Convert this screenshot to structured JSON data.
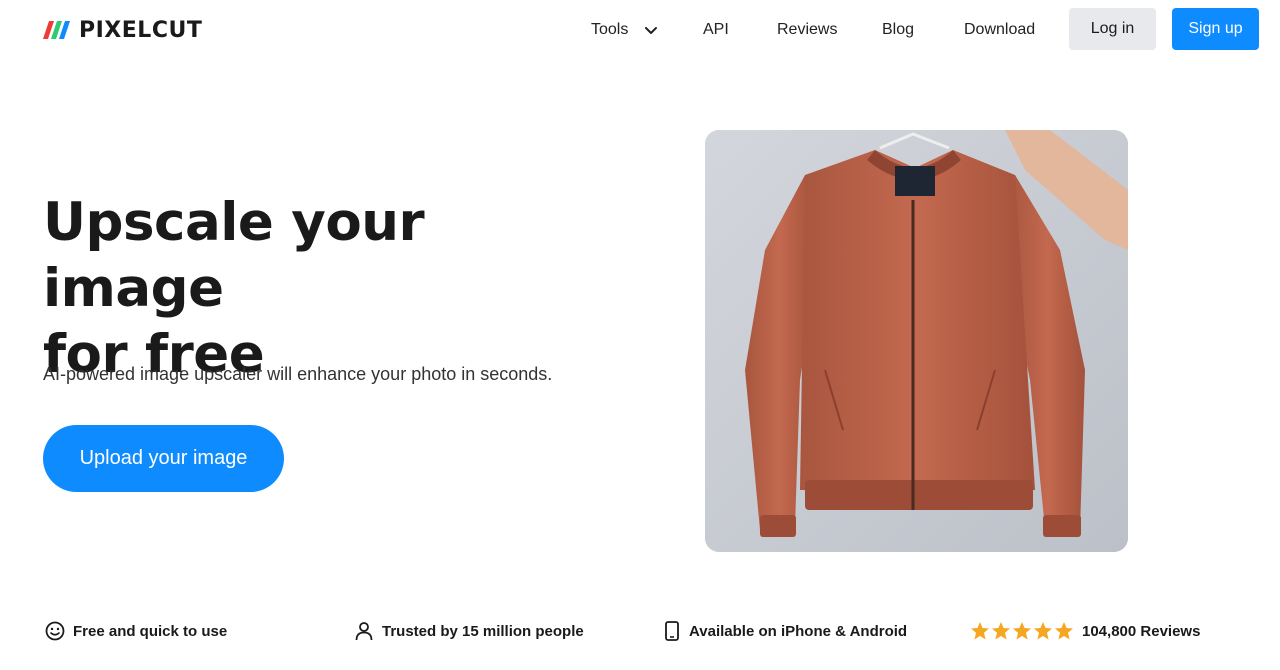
{
  "header": {
    "brand": "PIXELCUT",
    "brand_colors": [
      "#ef3b36",
      "#2ecc71",
      "#0e8bff"
    ],
    "nav": {
      "tools": "Tools",
      "api": "API",
      "reviews": "Reviews",
      "blog": "Blog",
      "download": "Download"
    },
    "login_label": "Log in",
    "signup_label": "Sign up"
  },
  "hero": {
    "title_line1": "Upscale your image",
    "title_line2": "for free",
    "subtitle": "AI-powered image upscaler will enhance your photo in seconds.",
    "cta_label": "Upload your image",
    "image_icon": "jacket-photo"
  },
  "features": {
    "free": {
      "icon": "smiley-icon",
      "label": "Free and quick to use"
    },
    "trusted": {
      "icon": "user-icon",
      "label": "Trusted by 15 million people"
    },
    "available": {
      "icon": "phone-icon",
      "label": "Available on iPhone & Android"
    },
    "reviews": {
      "icon": "star-icon",
      "stars": 5,
      "label": "104,800 Reviews"
    }
  },
  "colors": {
    "accent": "#0e8bff",
    "login_bg": "#e8e9ec",
    "star": "#f5a623"
  }
}
